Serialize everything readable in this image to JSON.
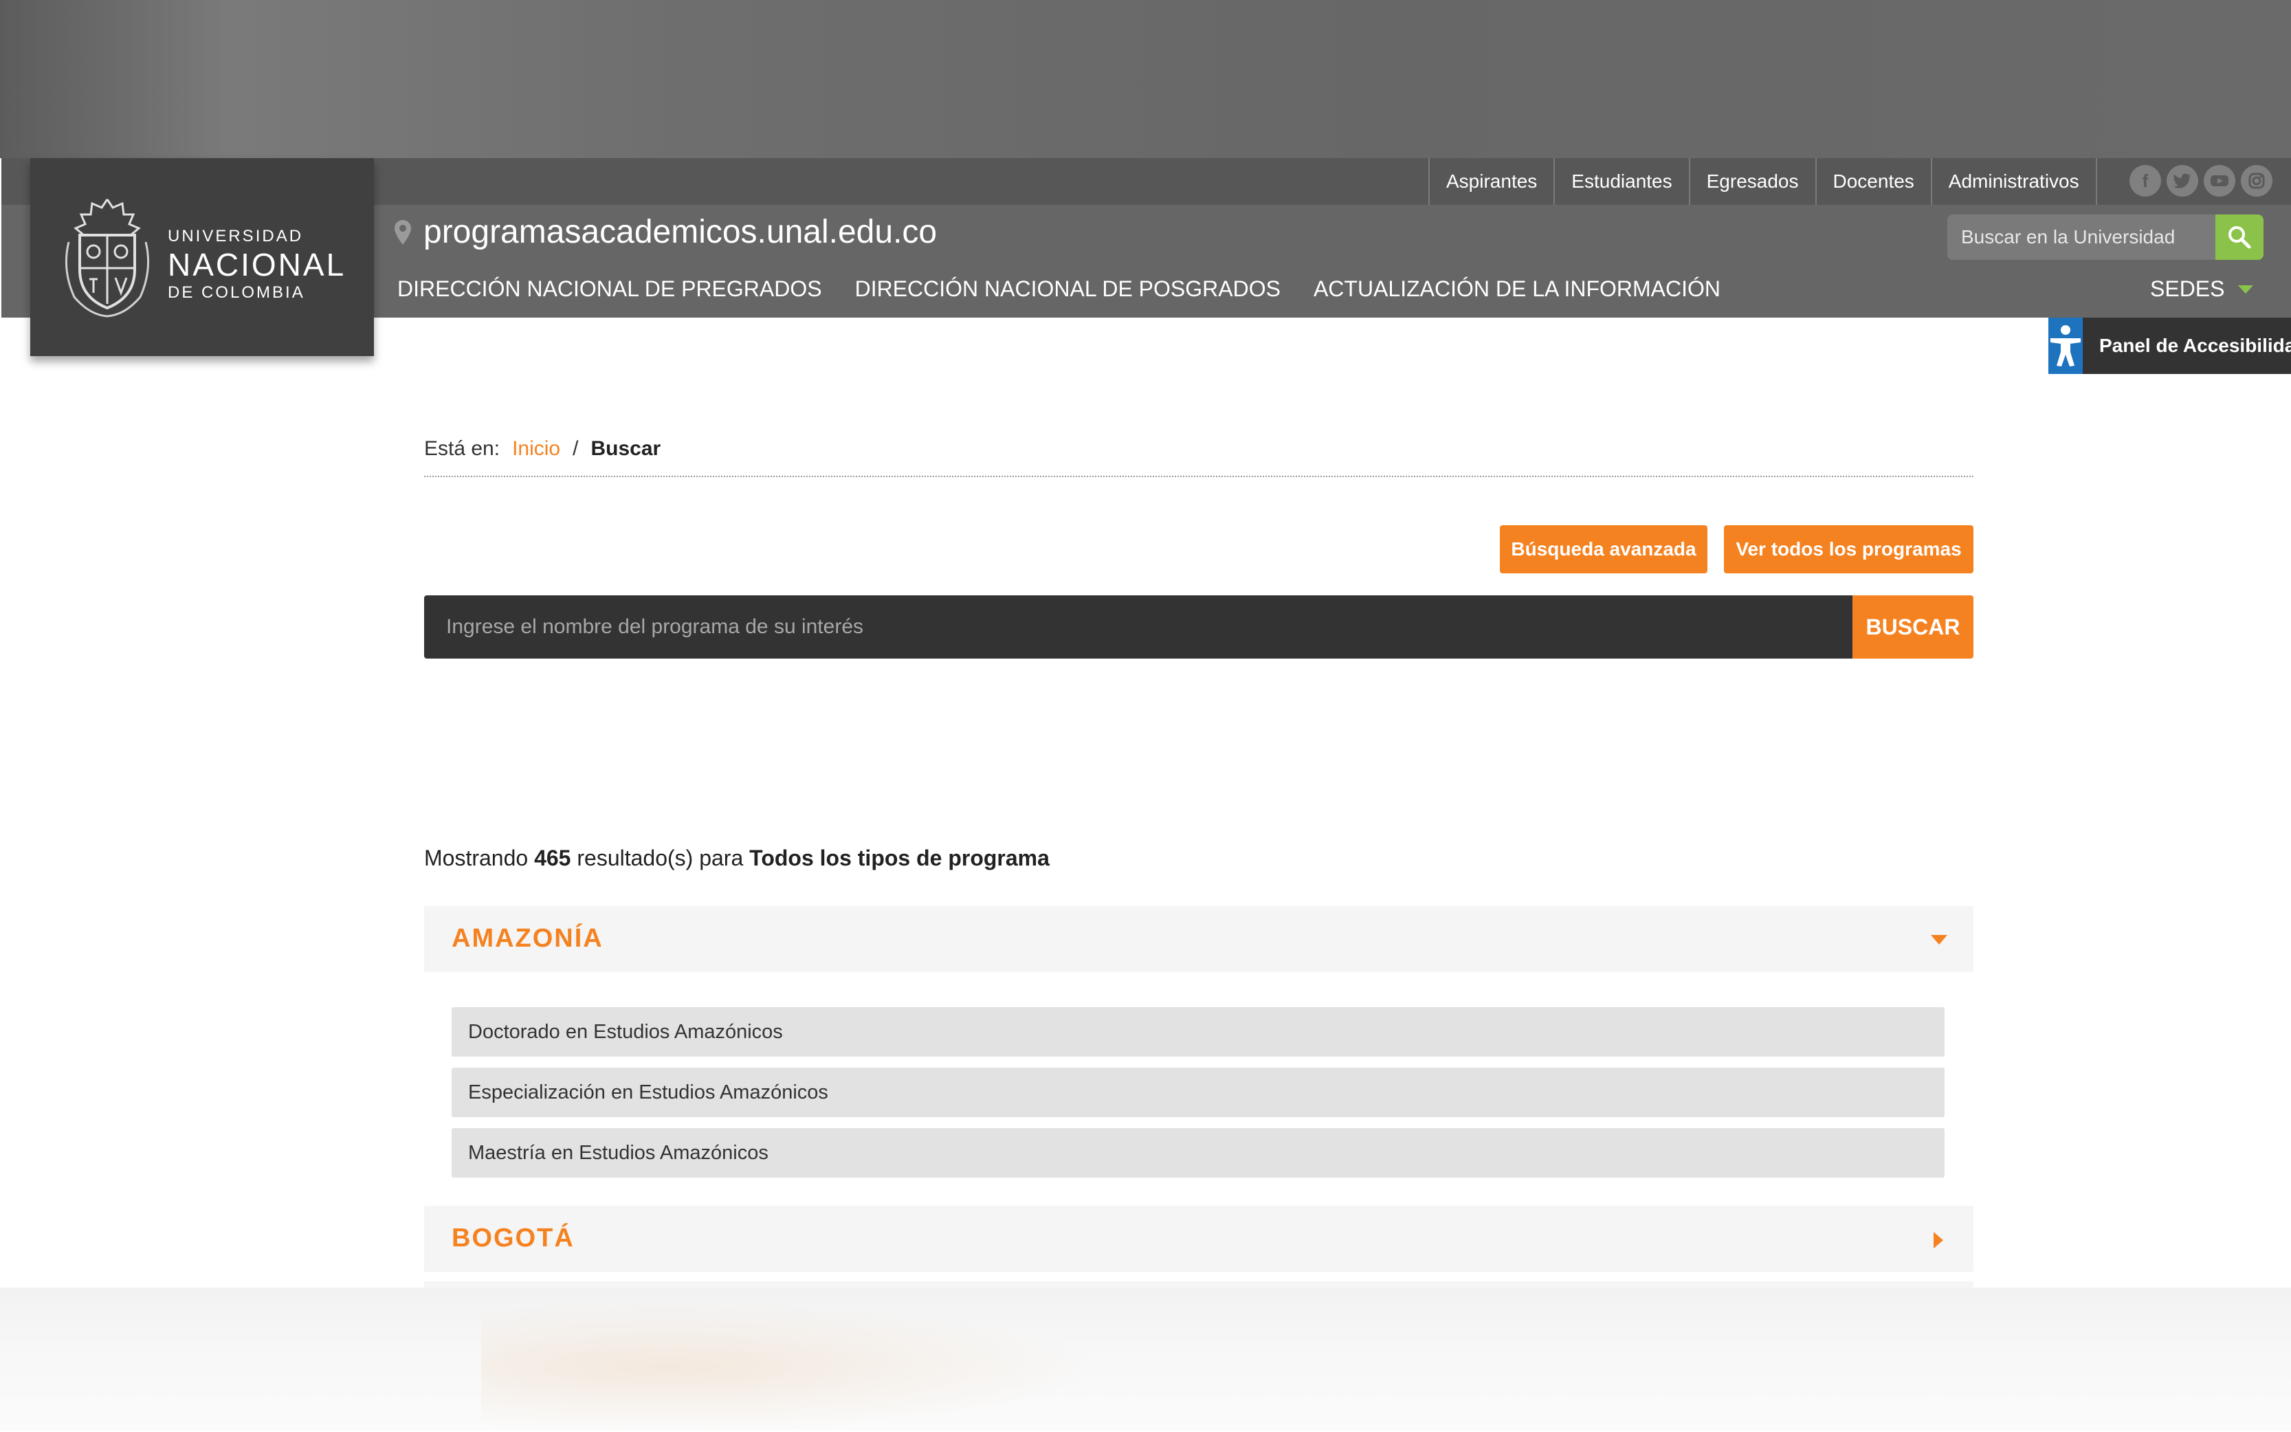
{
  "header": {
    "role_links": [
      "Aspirantes",
      "Estudiantes",
      "Egresados",
      "Docentes",
      "Administrativos"
    ],
    "social_icons": [
      "facebook-icon",
      "twitter-icon",
      "youtube-icon",
      "instagram-icon"
    ],
    "logo": {
      "line1": "UNIVERSIDAD",
      "line2": "NACIONAL",
      "line3": "DE COLOMBIA"
    },
    "site_url": "programasacademicos.unal.edu.co",
    "search_placeholder": "Buscar en la Universidad",
    "nav_items": [
      "DIRECCIÓN NACIONAL DE PREGRADOS",
      "DIRECCIÓN NACIONAL DE POSGRADOS",
      "ACTUALIZACIÓN DE LA INFORMACIÓN"
    ],
    "sedes_label": "SEDES"
  },
  "accessibility": {
    "label": "Panel de Accesibilidad"
  },
  "breadcrumb": {
    "prefix": "Está en:",
    "home": "Inicio",
    "separator": "/",
    "current": "Buscar"
  },
  "actions": {
    "advanced_search": "Búsqueda avanzada",
    "all_programs": "Ver todos los programas"
  },
  "program_search": {
    "placeholder": "Ingrese el nombre del programa de su interés",
    "button": "BUSCAR"
  },
  "results": {
    "prefix": "Mostrando",
    "count": "465",
    "middle": "resultado(s) para",
    "filter": "Todos los tipos de programa"
  },
  "sections": [
    {
      "title": "AMAZONÍA",
      "expanded": true,
      "programs": [
        "Doctorado en Estudios Amazónicos",
        "Especialización en Estudios Amazónicos",
        "Maestría en Estudios Amazónicos"
      ]
    },
    {
      "title": "BOGOTÁ",
      "expanded": false,
      "programs": []
    }
  ],
  "colors": {
    "accent": "#f58220",
    "header_bg": "#666666",
    "topbar_bg": "#575757",
    "search_green": "#8bc34a",
    "a11y_blue": "#1e73be"
  }
}
